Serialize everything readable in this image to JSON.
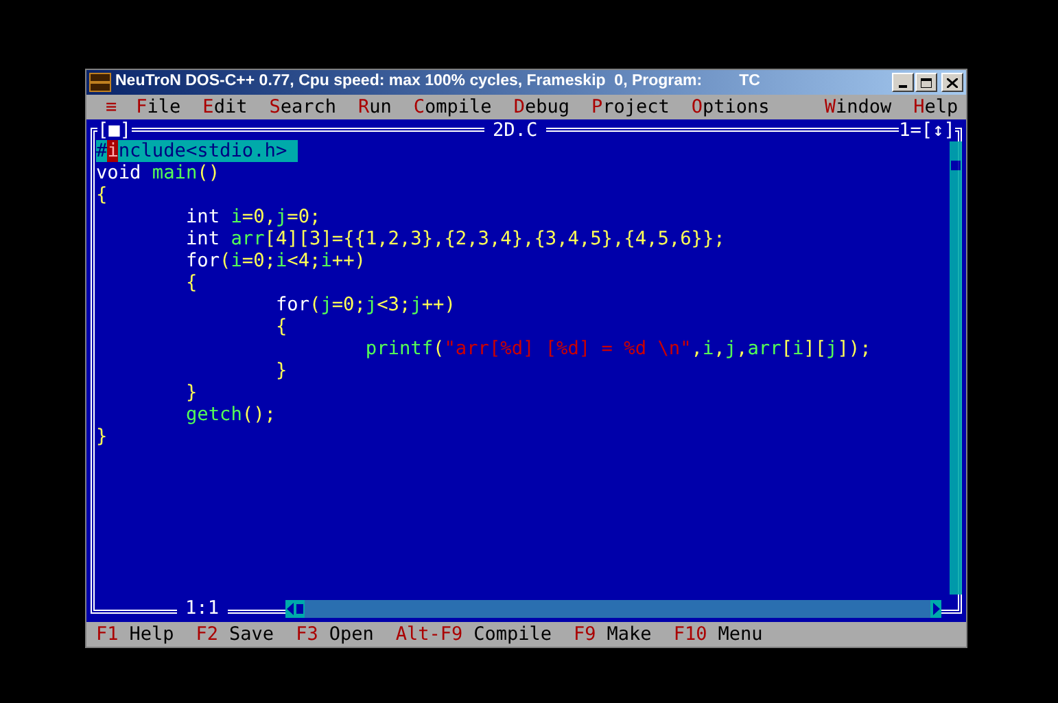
{
  "window": {
    "title": "NeuTroN DOS-C++ 0.77, Cpu speed: max 100% cycles, Frameskip  0, Program:",
    "program": "TC"
  },
  "menu": [
    {
      "hotkey": "≡"
    },
    {
      "hotkey": "F",
      "rest": "ile"
    },
    {
      "hotkey": "E",
      "rest": "dit"
    },
    {
      "hotkey": "S",
      "rest": "earch"
    },
    {
      "hotkey": "R",
      "rest": "un"
    },
    {
      "hotkey": "C",
      "rest": "ompile"
    },
    {
      "hotkey": "D",
      "rest": "ebug"
    },
    {
      "hotkey": "P",
      "rest": "roject"
    },
    {
      "hotkey": "O",
      "rest": "ptions"
    },
    {
      "hotkey": "W",
      "rest": "indow"
    },
    {
      "hotkey": "H",
      "rest": "elp"
    }
  ],
  "editor": {
    "close_box": "[■]",
    "file_name": "2D.C",
    "window_number": "1=[↕]",
    "cursor_position": "1:1",
    "lines": [
      [
        {
          "kind": "selected",
          "text": "#"
        },
        {
          "kind": "cursor",
          "text": "i"
        },
        {
          "kind": "selected",
          "text": "nclude<stdio.h> "
        }
      ],
      [
        {
          "kind": "keyword",
          "text": "void "
        },
        {
          "kind": "ident",
          "text": "main"
        },
        {
          "kind": "punct",
          "text": "()"
        }
      ],
      [
        {
          "kind": "punct",
          "text": "{"
        }
      ],
      [
        {
          "kind": "keyword",
          "text": "        int "
        },
        {
          "kind": "ident",
          "text": "i"
        },
        {
          "kind": "punct",
          "text": "=0,"
        },
        {
          "kind": "ident",
          "text": "j"
        },
        {
          "kind": "punct",
          "text": "=0;"
        }
      ],
      [
        {
          "kind": "keyword",
          "text": "        int "
        },
        {
          "kind": "ident",
          "text": "arr"
        },
        {
          "kind": "punct",
          "text": "[4][3]={{1,2,3},{2,3,4},{3,4,5},{4,5,6}};"
        }
      ],
      [
        {
          "kind": "keyword",
          "text": "        for"
        },
        {
          "kind": "punct",
          "text": "("
        },
        {
          "kind": "ident",
          "text": "i"
        },
        {
          "kind": "punct",
          "text": "=0;"
        },
        {
          "kind": "ident",
          "text": "i"
        },
        {
          "kind": "punct",
          "text": "<4;"
        },
        {
          "kind": "ident",
          "text": "i"
        },
        {
          "kind": "punct",
          "text": "++)"
        }
      ],
      [
        {
          "kind": "punct",
          "text": "        {"
        }
      ],
      [
        {
          "kind": "keyword",
          "text": "                for"
        },
        {
          "kind": "punct",
          "text": "("
        },
        {
          "kind": "ident",
          "text": "j"
        },
        {
          "kind": "punct",
          "text": "=0;"
        },
        {
          "kind": "ident",
          "text": "j"
        },
        {
          "kind": "punct",
          "text": "<3;"
        },
        {
          "kind": "ident",
          "text": "j"
        },
        {
          "kind": "punct",
          "text": "++)"
        }
      ],
      [
        {
          "kind": "punct",
          "text": "                {"
        }
      ],
      [
        {
          "kind": "ident",
          "text": "                        printf"
        },
        {
          "kind": "punct",
          "text": "("
        },
        {
          "kind": "string",
          "text": "\"arr[%d] [%d] = %d \\n\""
        },
        {
          "kind": "punct",
          "text": ","
        },
        {
          "kind": "ident",
          "text": "i"
        },
        {
          "kind": "punct",
          "text": ","
        },
        {
          "kind": "ident",
          "text": "j"
        },
        {
          "kind": "punct",
          "text": ","
        },
        {
          "kind": "ident",
          "text": "arr"
        },
        {
          "kind": "punct",
          "text": "["
        },
        {
          "kind": "ident",
          "text": "i"
        },
        {
          "kind": "punct",
          "text": "]["
        },
        {
          "kind": "ident",
          "text": "j"
        },
        {
          "kind": "punct",
          "text": "]);"
        }
      ],
      [
        {
          "kind": "punct",
          "text": "                }"
        }
      ],
      [
        {
          "kind": "punct",
          "text": "        }"
        }
      ],
      [
        {
          "kind": "ident",
          "text": "        getch"
        },
        {
          "kind": "punct",
          "text": "();"
        }
      ],
      [
        {
          "kind": "punct",
          "text": "}"
        }
      ]
    ]
  },
  "status_bar": [
    {
      "key": "F1",
      "label": "Help"
    },
    {
      "key": "F2",
      "label": "Save"
    },
    {
      "key": "F3",
      "label": "Open"
    },
    {
      "key": "Alt-F9",
      "label": "Compile"
    },
    {
      "key": "F9",
      "label": "Make"
    },
    {
      "key": "F10",
      "label": "Menu"
    }
  ]
}
